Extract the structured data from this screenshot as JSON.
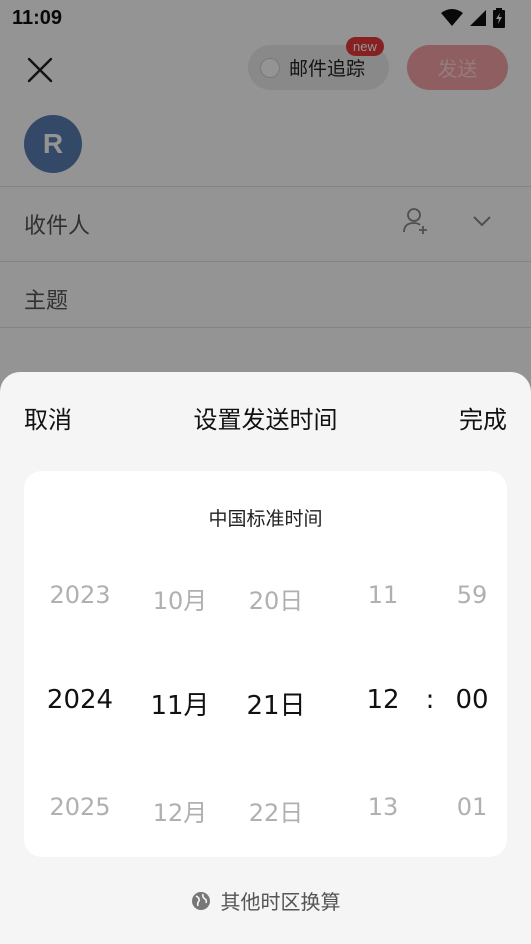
{
  "status_bar": {
    "time": "11:09"
  },
  "header": {
    "track_label": "邮件追踪",
    "new_badge": "new",
    "send_label": "发送"
  },
  "avatar": {
    "initial": "R"
  },
  "fields": {
    "recipient_label": "收件人",
    "subject_label": "主题"
  },
  "sheet": {
    "cancel_label": "取消",
    "title": "设置发送时间",
    "done_label": "完成",
    "timezone_label": "中国标准时间",
    "convert_label": "其他时区换算",
    "columns": {
      "year": {
        "prev": "2023",
        "selected": "2024",
        "next": "2025"
      },
      "month": {
        "prev": "10月",
        "selected": "11月",
        "next": "12月"
      },
      "day": {
        "prev": "20日",
        "selected": "21日",
        "next": "22日"
      },
      "hour": {
        "prev": "11",
        "selected": "12",
        "next": "13"
      },
      "minute": {
        "prev": "59",
        "selected": "00",
        "next": "01"
      }
    },
    "separator": ":"
  },
  "colors": {
    "accent_red": "#e8393a",
    "send_disabled": "#f4a3a5",
    "avatar_bg": "#5b7cb2"
  }
}
